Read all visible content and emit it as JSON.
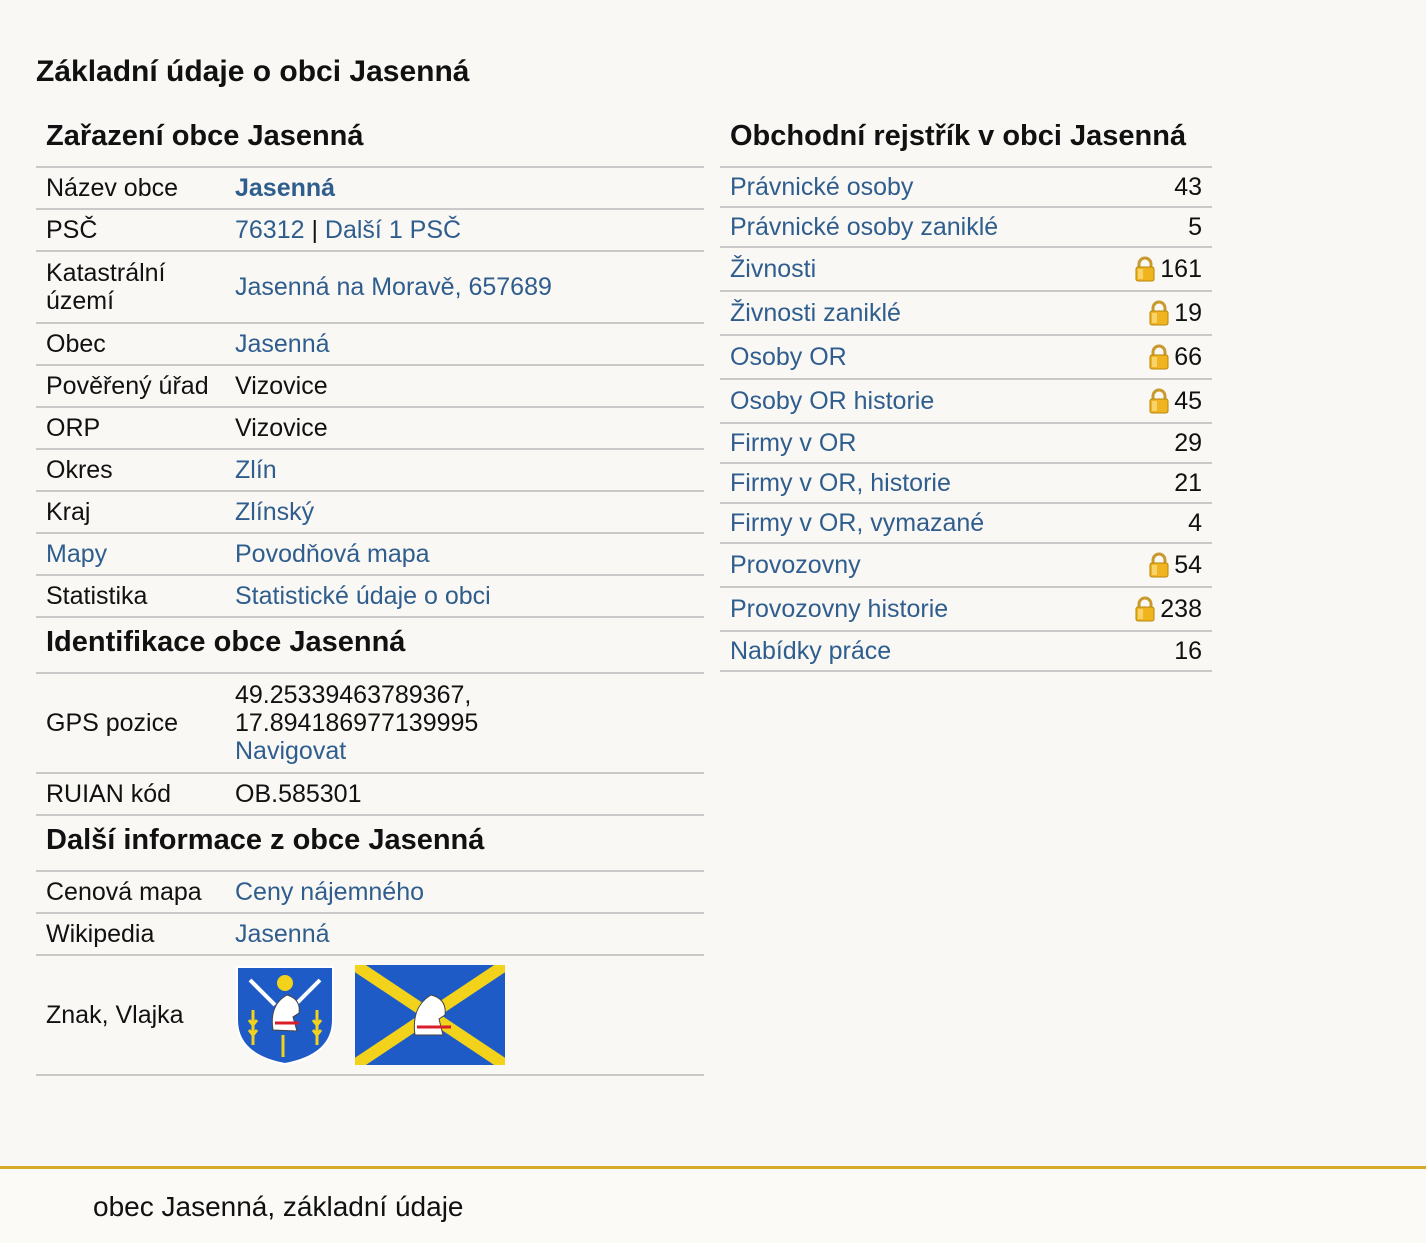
{
  "page_title": "Základní údaje o obci Jasenná",
  "zarazeni": {
    "heading": "Zařazení obce Jasenná",
    "nazev_label": "Název obce",
    "nazev_value": "Jasenná",
    "psc_label": "PSČ",
    "psc_value": "76312",
    "psc_sep": " | ",
    "psc_more": "Další 1 PSČ",
    "katastr_label": "Katastrální území",
    "katastr_value": "Jasenná na Moravě, 657689",
    "obec_label": "Obec",
    "obec_value": "Jasenná",
    "urad_label": "Pověřený úřad",
    "urad_value": "Vizovice",
    "orp_label": "ORP",
    "orp_value": "Vizovice",
    "okres_label": "Okres",
    "okres_value": "Zlín",
    "kraj_label": "Kraj",
    "kraj_value": "Zlínský",
    "mapy_label": "Mapy",
    "mapy_value": "Povodňová mapa",
    "stat_label": "Statistika",
    "stat_value": "Statistické údaje o obci"
  },
  "identifikace": {
    "heading": "Identifikace obce Jasenná",
    "gps_label": "GPS pozice",
    "gps_lat": "49.25339463789367,",
    "gps_lon": "17.894186977139995",
    "gps_nav": "Navigovat",
    "ruian_label": "RUIAN kód",
    "ruian_value": "OB.585301"
  },
  "dalsi": {
    "heading": "Další informace z obce Jasenná",
    "cenova_label": "Cenová mapa",
    "cenova_value": "Ceny nájemného",
    "wiki_label": "Wikipedia",
    "wiki_value": "Jasenná",
    "znak_label": "Znak, Vlajka"
  },
  "rejstrik": {
    "heading": "Obchodní rejstřík v obci Jasenná",
    "items": [
      {
        "label": "Právnické osoby",
        "count": "43",
        "locked": false
      },
      {
        "label": "Právnické osoby zaniklé",
        "count": "5",
        "locked": false
      },
      {
        "label": "Živnosti",
        "count": "161",
        "locked": true
      },
      {
        "label": "Živnosti zaniklé",
        "count": "19",
        "locked": true
      },
      {
        "label": "Osoby OR",
        "count": "66",
        "locked": true
      },
      {
        "label": "Osoby OR historie",
        "count": "45",
        "locked": true
      },
      {
        "label": "Firmy v OR",
        "count": "29",
        "locked": false
      },
      {
        "label": "Firmy v OR, historie",
        "count": "21",
        "locked": false
      },
      {
        "label": "Firmy v OR, vymazané",
        "count": "4",
        "locked": false
      },
      {
        "label": "Provozovny",
        "count": "54",
        "locked": true
      },
      {
        "label": "Provozovny historie",
        "count": "238",
        "locked": true
      },
      {
        "label": "Nabídky práce",
        "count": "16",
        "locked": false
      }
    ]
  },
  "footer": {
    "text": "obec Jasenná, základní údaje"
  },
  "colors": {
    "link": "#2f5d8e",
    "footer_border": "#d7a928",
    "coat_blue": "#1f5bc7",
    "flag_yellow": "#f2d21a"
  },
  "icons": {
    "lock": "lock-icon"
  }
}
